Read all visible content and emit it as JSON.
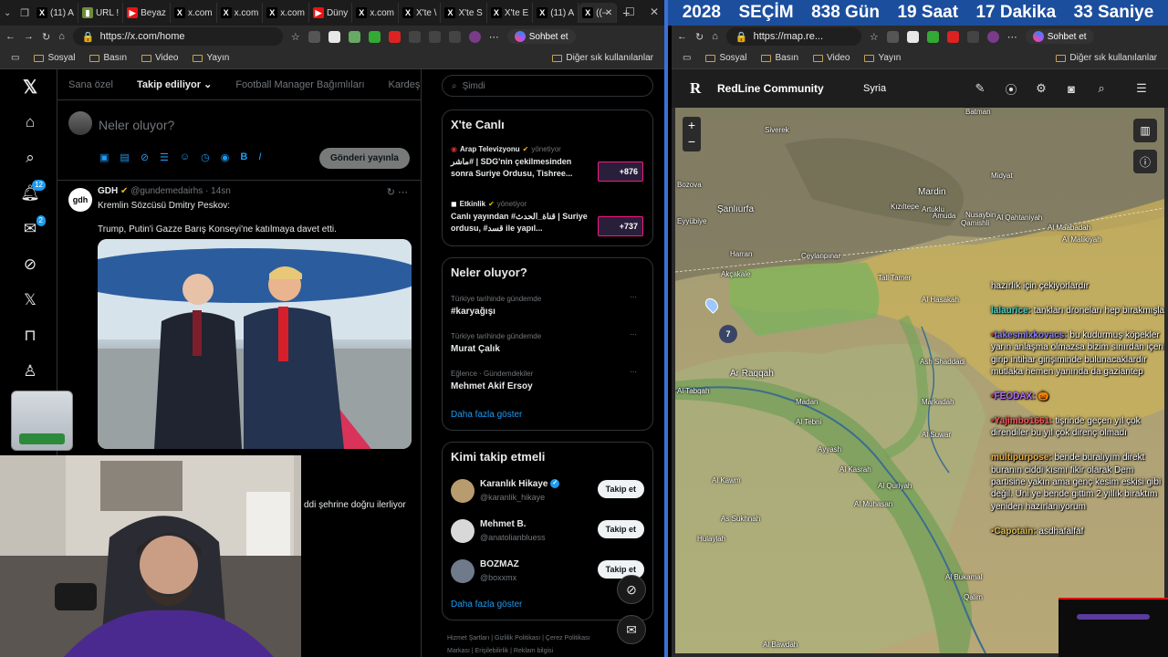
{
  "countdown": {
    "year": "2028",
    "label": "SEÇİM",
    "days": "838 Gün",
    "hours": "19 Saat",
    "minutes": "17 Dakika",
    "seconds": "33 Saniye"
  },
  "left_browser": {
    "tabs": [
      "(11) A",
      "URL !",
      "Beyaz",
      "x.com",
      "x.com",
      "x.com",
      "Düny",
      "x.com",
      "X'te \\",
      "X'te S",
      "X'te E",
      "(11) A",
      "(("
    ],
    "url": "https://x.com/home",
    "chat_button": "Sohbet et",
    "bookmarks": [
      "Sosyal",
      "Basın",
      "Video",
      "Yayın"
    ],
    "other_bookmarks": "Diğer sık kullanılanlar"
  },
  "right_browser": {
    "url": "https://map.re...",
    "chat_button": "Sohbet et",
    "bookmarks": [
      "Sosyal",
      "Basın",
      "Video",
      "Yayın"
    ],
    "other_bookmarks": "Diğer sık kullanılanlar"
  },
  "x": {
    "nav_badges": {
      "notifications": "12",
      "messages": "2"
    },
    "feed_tabs": [
      "Sana özel",
      "Takip ediliyor",
      "Football Manager Bağımlıları",
      "Kardeşler Kıraathanesi"
    ],
    "compose": {
      "placeholder": "Neler oluyor?",
      "post_button": "Gönderi yayınla"
    },
    "tweet": {
      "author": "GDH",
      "handle": "@gundemedairhs · 14sn",
      "line1": "Kremlin Sözcüsü Dmitry Peskov:",
      "line2": "Trump, Putin'i Gazze Barış Konseyi'ne katılmaya davet etti.",
      "avatar_text": "gdh"
    },
    "tweet2_partial": "ddi şehrine doğru ilerliyor",
    "search_placeholder": "Şimdi",
    "live": {
      "title": "X'te Canlı",
      "items": [
        {
          "source": "Arap Televizyonu",
          "role": "yönetiyor",
          "text": "ماشر# | SDG'nin çekilmesinden sonra Suriye Ordusu, Tishree...",
          "count": "+876"
        },
        {
          "source": "Etkinlik",
          "role": "yönetiyor",
          "text": "Canlı yayından #قناة_الحدث | Suriye ordusu, #قسد ile yapıl...",
          "count": "+737"
        }
      ]
    },
    "trends": {
      "title": "Neler oluyor?",
      "items": [
        {
          "context": "Türkiye tarihinde gündemde",
          "name": "#karyağışı"
        },
        {
          "context": "Türkiye tarihinde gündemde",
          "name": "Murat Çalık"
        },
        {
          "context": "Eğlence · Gündemdekiler",
          "name": "Mehmet Akif Ersoy"
        }
      ],
      "more": "Daha fazla göster"
    },
    "who": {
      "title": "Kimi takip etmeli",
      "items": [
        {
          "name": "Karanlık Hikaye",
          "handle": "@karanlik_hikaye",
          "button": "Takip et"
        },
        {
          "name": "Mehmet B.",
          "handle": "@anatolianbluess",
          "button": "Takip et"
        },
        {
          "name": "BOZMAZ",
          "handle": "@boxxmx",
          "button": "Takip et"
        }
      ],
      "more": "Daha fazla göster"
    },
    "footer": [
      "Hizmet Şartları",
      "Gizlilik Politikası",
      "Çerez Politikası"
    ],
    "footer2": [
      "Markası",
      "Erişilebilirlik",
      "Reklam bilgisi"
    ]
  },
  "map": {
    "logo": "R",
    "title": "RedLine Community",
    "region": "Syria",
    "pin_count": "7",
    "cities": [
      "Batman",
      "Siverek",
      "Midyat",
      "Mardin",
      "Bozova",
      "Şanlıurfa",
      "Eyyübiye",
      "Kızıltepe",
      "Artuklu",
      "Nusaybin",
      "Al Qahtaniyah",
      "Al Maabadah",
      "Al Malikiyah",
      "Amuda",
      "Qamishli",
      "Harran",
      "Ceylanpınar",
      "Akçakale",
      "Tall Tamer",
      "Al Hasakah",
      "Ash Shaddadi",
      "Markadah",
      "Ar Raqqah",
      "Madan",
      "Al Tabqah",
      "Al Tebni",
      "Ayyash",
      "Al Kasrah",
      "Al Suwar",
      "Al Kawm",
      "As Sukhnah",
      "Hulaylah",
      "Al Quriyah",
      "Al Bukamal",
      "Qalim",
      "Al Bawdah",
      "Al Muhasan"
    ],
    "chat": [
      {
        "user": "",
        "text": "hazırlık için çekiyorlardır"
      },
      {
        "user": "lalaurice:",
        "text": " tankları droneları hep bırakmışlar"
      },
      {
        "user": "takesmixkovacs:",
        "text": " bu kudurmuş köpekler yarın anlaşma olmazsa bizim sınırdan içeri girip intihar girişiminde bulunacaklardır mutlaka hemen yanında da gaziantep"
      },
      {
        "user": "FEODAX:",
        "text": " 🎃"
      },
      {
        "user": "Yajimbo1661:",
        "text": " tişrinde geçen yıl çok direndiler bu yıl çok direnç olmadı"
      },
      {
        "user": "multipurpose:",
        "text": " bende buralıyım direkt buranın ciddi kısmı fikir olarak Dem partisine yakın ama genç kesim eskisi gibi değil. Uni ye bende gittim 2 yıllık bıraktım yeniden hazırlanıyorum"
      },
      {
        "user": "Capotain:",
        "text": " asdhafalfaf"
      }
    ]
  },
  "colors": {
    "x_blue": "#1d9bf0",
    "countdown_bg": "#1c4e9e",
    "sdf_zone": "#c9b25a",
    "gov_zone": "#79b35e"
  }
}
